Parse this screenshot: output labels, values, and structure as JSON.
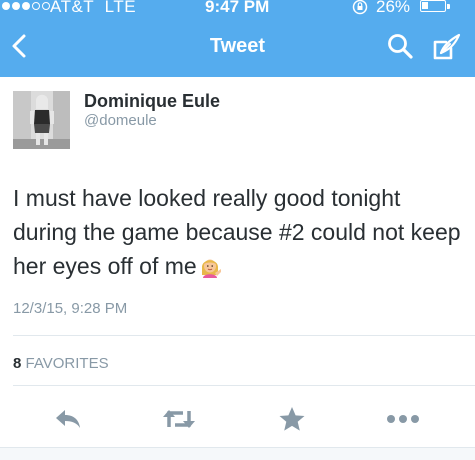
{
  "status_bar": {
    "carrier": "AT&T",
    "network": "LTE",
    "time": "9:47 PM",
    "battery_percent": "26%",
    "battery_level": 0.26,
    "signal_bars_filled": 3,
    "signal_bars_total": 5
  },
  "nav": {
    "title": "Tweet",
    "back_icon": "chevron-left-icon",
    "search_icon": "search-icon",
    "compose_icon": "compose-icon"
  },
  "tweet": {
    "display_name": "Dominique Eule",
    "handle": "@domeule",
    "text": "I must have looked really good tonight during the game because #2 could not keep her eyes off of me",
    "emoji": "woman-tipping-hand-emoji",
    "timestamp": "12/3/15, 9:28 PM",
    "favorites_count": "8",
    "favorites_label": "FAVORITES"
  },
  "actions": [
    "reply-icon",
    "retweet-icon",
    "favorite-star-icon",
    "more-icon"
  ],
  "colors": {
    "brand_blue": "#55acee",
    "text": "#292f33",
    "secondary_text": "#8899a6",
    "action_icon": "#8899a6",
    "divider": "#e1e8ed"
  }
}
